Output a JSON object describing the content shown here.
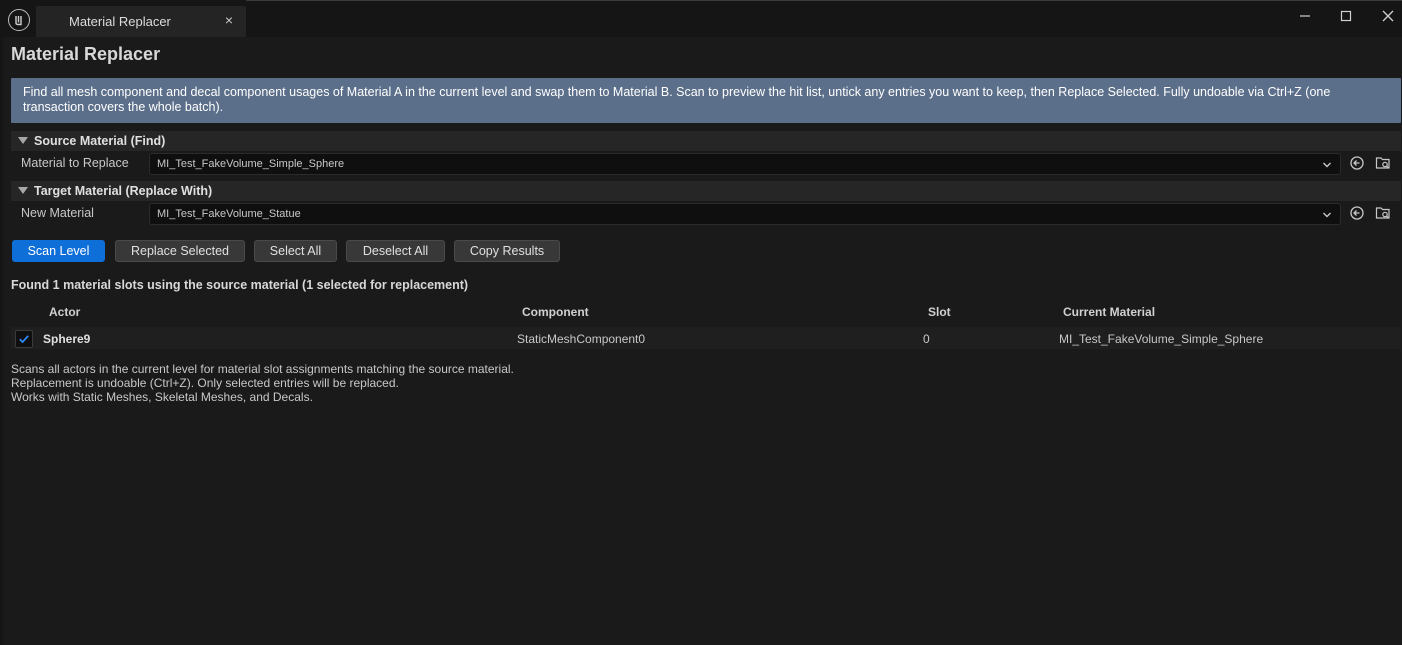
{
  "window": {
    "tab_title": "Material Replacer",
    "tab_close": "×"
  },
  "panel": {
    "title": "Material Replacer",
    "info": "Find all mesh component and decal component usages of Material A in the current level and swap them to Material B. Scan to preview the hit list, untick any entries you want to keep, then Replace Selected. Fully undoable via Ctrl+Z (one transaction covers the whole batch)."
  },
  "source": {
    "header": "Source Material (Find)",
    "label": "Material to Replace",
    "value": "MI_Test_FakeVolume_Simple_Sphere"
  },
  "target": {
    "header": "Target Material (Replace With)",
    "label": "New Material",
    "value": "MI_Test_FakeVolume_Statue"
  },
  "buttons": {
    "scan": "Scan Level",
    "replace": "Replace Selected",
    "select_all": "Select All",
    "deselect_all": "Deselect All",
    "copy": "Copy Results"
  },
  "results": {
    "summary": "Found 1 material slots using the source material (1 selected for replacement)",
    "columns": [
      "Actor",
      "Component",
      "Slot",
      "Current Material"
    ],
    "rows": [
      {
        "checked": true,
        "actor": "Sphere9",
        "component": "StaticMeshComponent0",
        "slot": "0",
        "material": "MI_Test_FakeVolume_Simple_Sphere"
      }
    ]
  },
  "notes": [
    "Scans all actors in the current level for material slot assignments matching the source material.",
    "Replacement is undoable (Ctrl+Z). Only selected entries will be replaced.",
    "Works with Static Meshes, Skeletal Meshes, and Decals."
  ],
  "colors": {
    "accent": "#0e6fd8",
    "info_bg": "#5c6f8a",
    "check": "#2f8cff"
  }
}
